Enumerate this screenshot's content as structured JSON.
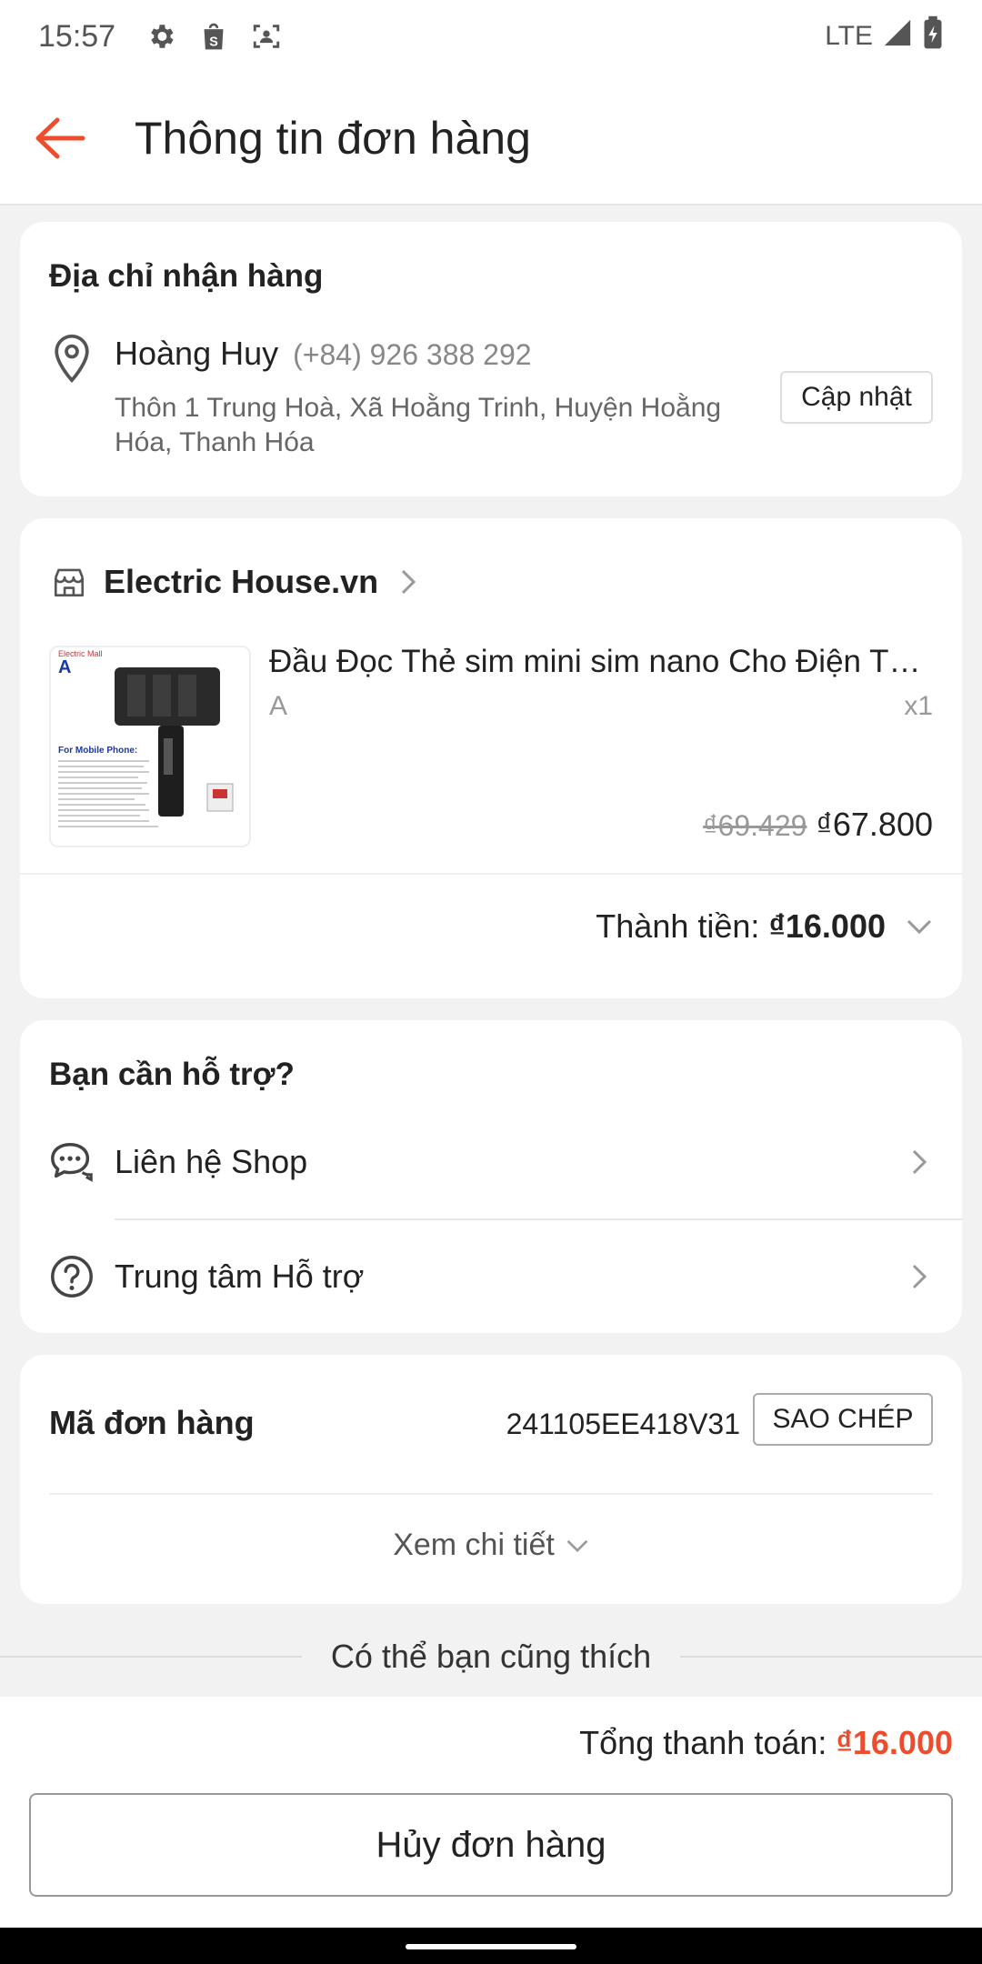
{
  "status_bar": {
    "time": "15:57",
    "network": "LTE"
  },
  "header": {
    "title": "Thông tin đơn hàng"
  },
  "address": {
    "section_title": "Địa chỉ nhận hàng",
    "name": "Hoàng Huy",
    "phone": "(+84) 926 388 292",
    "address": "Thôn 1 Trung Hoà, Xã Hoằng Trinh, Huyện Hoằng Hóa, Thanh Hóa",
    "update_label": "Cập nhật"
  },
  "shop": {
    "name": "Electric House.vn",
    "product": {
      "title": "Đầu Đọc Thẻ sim mini sim nano Cho Điện Thoại",
      "variant": "A",
      "qty": "x1",
      "price_old": "₫69.429",
      "price_new": "₫67.800",
      "image_text": {
        "brand": "Electric Mall",
        "letter": "A",
        "caption": "For Mobile Phone:"
      }
    },
    "total_label": "Thành tiền:",
    "total_value": "₫16.000"
  },
  "support": {
    "section_title": "Bạn cần hỗ trợ?",
    "items": [
      {
        "label": "Liên hệ Shop"
      },
      {
        "label": "Trung tâm Hỗ trợ"
      }
    ]
  },
  "order": {
    "label": "Mã đơn hàng",
    "code": "241105EE418V31",
    "copy_label": "SAO CHÉP",
    "detail_label": "Xem chi tiết"
  },
  "suggestions": {
    "label": "Có thể bạn cũng thích"
  },
  "footer": {
    "total_label": "Tổng thanh toán:",
    "total_value": "₫16.000",
    "cancel_label": "Hủy đơn hàng"
  },
  "colors": {
    "accent": "#ee4d2d",
    "background": "#f2f2f2",
    "card": "#ffffff"
  }
}
